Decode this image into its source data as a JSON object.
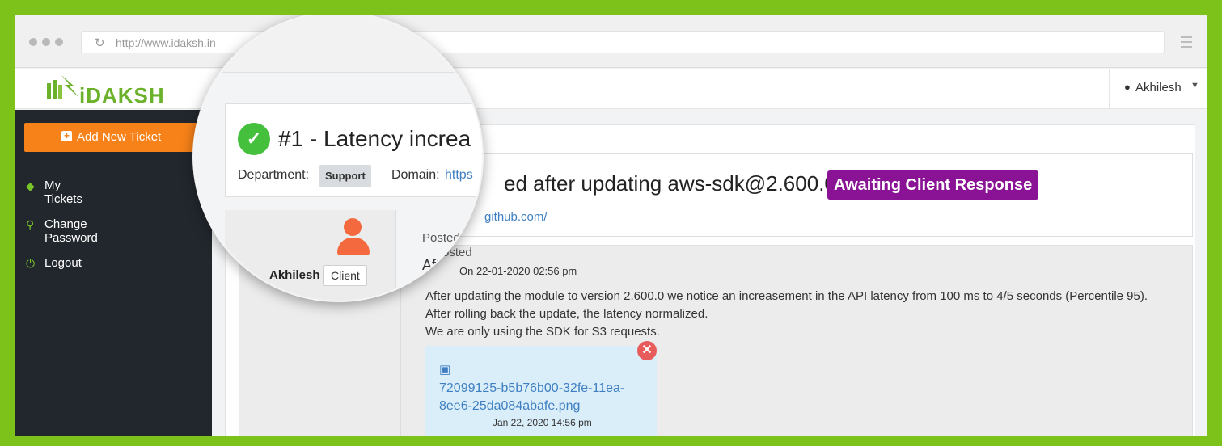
{
  "browser": {
    "url": "http://www.idaksh.in"
  },
  "header": {
    "logo_text": "iDAKSH",
    "user_name": "Akhilesh"
  },
  "sidebar": {
    "add_button_label": "Add New Ticket",
    "items": [
      {
        "label": "My Tickets",
        "icon": "ticket-icon"
      },
      {
        "label": "Change Password",
        "icon": "key-icon"
      },
      {
        "label": "Logout",
        "icon": "power-icon"
      }
    ]
  },
  "ticket": {
    "title_prefix": "#1 - Latency increa",
    "title_rest": "ed after updating aws-sdk@2.600.0",
    "status": "Awaiting Client Response",
    "status_color": "#8a1294",
    "department_label": "Department:",
    "department": "Support",
    "domain_label": "Domain:",
    "domain_prefix": "https",
    "domain_rest": "github.com/"
  },
  "reply": {
    "posted_label": "Posted",
    "author": "Akhilesh",
    "author_role": "Client",
    "first_word": "Aft",
    "date": "On 22-01-2020 02:56 pm",
    "message_lines": [
      "After updating the module to version 2.600.0 we notice an increasement in the API latency from 100 ms to 4/5 seconds (Percentile 95).",
      "After rolling back the update, the latency normalized.",
      "We are only using the SDK for S3 requests."
    ],
    "attachment": {
      "filename": "72099125-b5b76b00-32fe-11ea-8ee6-25da084abafe.png",
      "date": "Jan 22, 2020 14:56 pm"
    }
  },
  "colors": {
    "frame_green": "#7cc21a",
    "accent_orange": "#f78219",
    "sidebar_dark": "#22272e"
  }
}
